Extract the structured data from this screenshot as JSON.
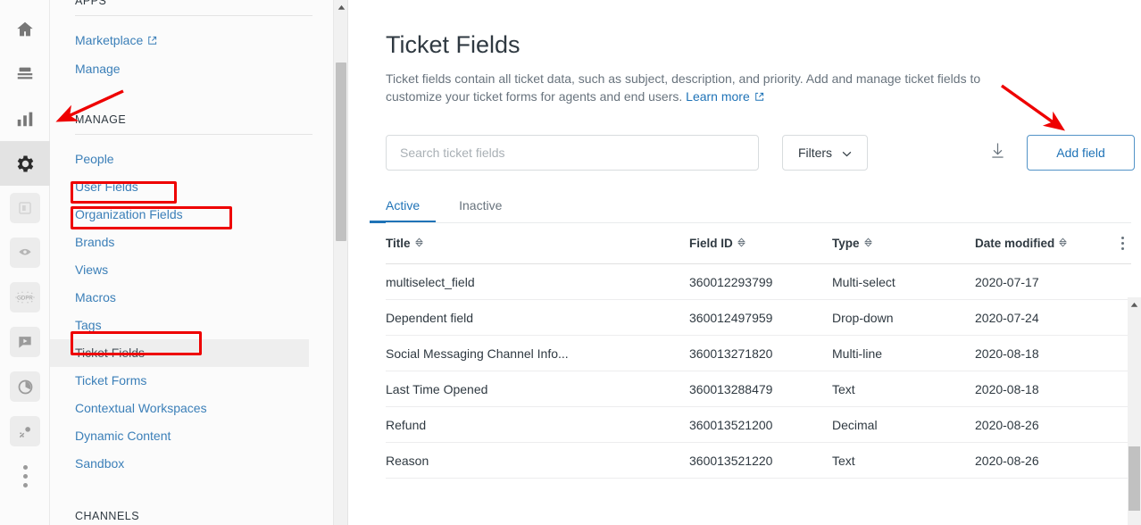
{
  "rail": {
    "items": [
      {
        "name": "home-icon",
        "label": "Home",
        "active": false,
        "chip": false
      },
      {
        "name": "views-icon",
        "label": "Views",
        "active": false,
        "chip": false
      },
      {
        "name": "reporting-icon",
        "label": "Reporting",
        "active": false,
        "chip": false
      },
      {
        "name": "gear-icon",
        "label": "Admin",
        "active": true,
        "chip": false
      },
      {
        "name": "app-card-icon",
        "label": "App",
        "active": false,
        "chip": true
      },
      {
        "name": "eye-icon",
        "label": "App",
        "active": false,
        "chip": true
      },
      {
        "name": "gdpr-icon",
        "label": "GDPR",
        "active": false,
        "chip": true
      },
      {
        "name": "chat-icon",
        "label": "Chat",
        "active": false,
        "chip": true
      },
      {
        "name": "globe-icon",
        "label": "Globe",
        "active": false,
        "chip": true
      },
      {
        "name": "spark-icon",
        "label": "Spark",
        "active": false,
        "chip": true
      }
    ],
    "more_label": "More"
  },
  "nav": {
    "apps_heading": "APPS",
    "apps_items": [
      {
        "label": "Marketplace",
        "external": true,
        "active": false,
        "highlight": false
      },
      {
        "label": "Manage",
        "external": false,
        "active": false,
        "highlight": false
      }
    ],
    "manage_heading": "MANAGE",
    "manage_items": [
      {
        "label": "People",
        "external": false,
        "active": false,
        "highlight": false
      },
      {
        "label": "User Fields",
        "external": false,
        "active": false,
        "highlight": true
      },
      {
        "label": "Organization Fields",
        "external": false,
        "active": false,
        "highlight": true
      },
      {
        "label": "Brands",
        "external": false,
        "active": false,
        "highlight": false
      },
      {
        "label": "Views",
        "external": false,
        "active": false,
        "highlight": false
      },
      {
        "label": "Macros",
        "external": false,
        "active": false,
        "highlight": false
      },
      {
        "label": "Tags",
        "external": false,
        "active": false,
        "highlight": false
      },
      {
        "label": "Ticket Fields",
        "external": false,
        "active": true,
        "highlight": true
      },
      {
        "label": "Ticket Forms",
        "external": false,
        "active": false,
        "highlight": false
      },
      {
        "label": "Contextual Workspaces",
        "external": false,
        "active": false,
        "highlight": false
      },
      {
        "label": "Dynamic Content",
        "external": false,
        "active": false,
        "highlight": false
      },
      {
        "label": "Sandbox",
        "external": false,
        "active": false,
        "highlight": false
      }
    ],
    "channels_heading": "CHANNELS"
  },
  "page": {
    "title": "Ticket Fields",
    "description": "Ticket fields contain all ticket data, such as subject, description, and priority. Add and manage ticket fields to customize your ticket forms for agents and end users. ",
    "learn_more": "Learn more"
  },
  "toolbar": {
    "search_placeholder": "Search ticket fields",
    "search_value": "",
    "filters_label": "Filters",
    "download_label": "Export",
    "add_field_label": "Add field"
  },
  "tabs": [
    {
      "label": "Active",
      "active": true
    },
    {
      "label": "Inactive",
      "active": false
    }
  ],
  "table": {
    "columns": [
      "Title",
      "Field ID",
      "Type",
      "Date modified"
    ],
    "rows": [
      {
        "title": "multiselect_field",
        "field_id": "360012293799",
        "type": "Multi-select",
        "date_modified": "2020-07-17"
      },
      {
        "title": "Dependent field",
        "field_id": "360012497959",
        "type": "Drop-down",
        "date_modified": "2020-07-24"
      },
      {
        "title": "Social Messaging Channel Info...",
        "field_id": "360013271820",
        "type": "Multi-line",
        "date_modified": "2020-08-18"
      },
      {
        "title": "Last Time Opened",
        "field_id": "360013288479",
        "type": "Text",
        "date_modified": "2020-08-18"
      },
      {
        "title": "Refund",
        "field_id": "360013521200",
        "type": "Decimal",
        "date_modified": "2020-08-26"
      },
      {
        "title": "Reason",
        "field_id": "360013521220",
        "type": "Text",
        "date_modified": "2020-08-26"
      }
    ]
  },
  "colors": {
    "link": "#1f73b7",
    "nav_link": "#3b7fb8",
    "text": "#2f3941",
    "muted": "#68737d",
    "annotation": "#ee0000",
    "active_tab_underline": "#1f73b7"
  },
  "annotations": {
    "arrow_manage": "arrow pointing to MANAGE section heading",
    "arrow_add_field": "arrow pointing to Add field button",
    "boxes": [
      "User Fields",
      "Organization Fields",
      "Ticket Fields"
    ]
  }
}
